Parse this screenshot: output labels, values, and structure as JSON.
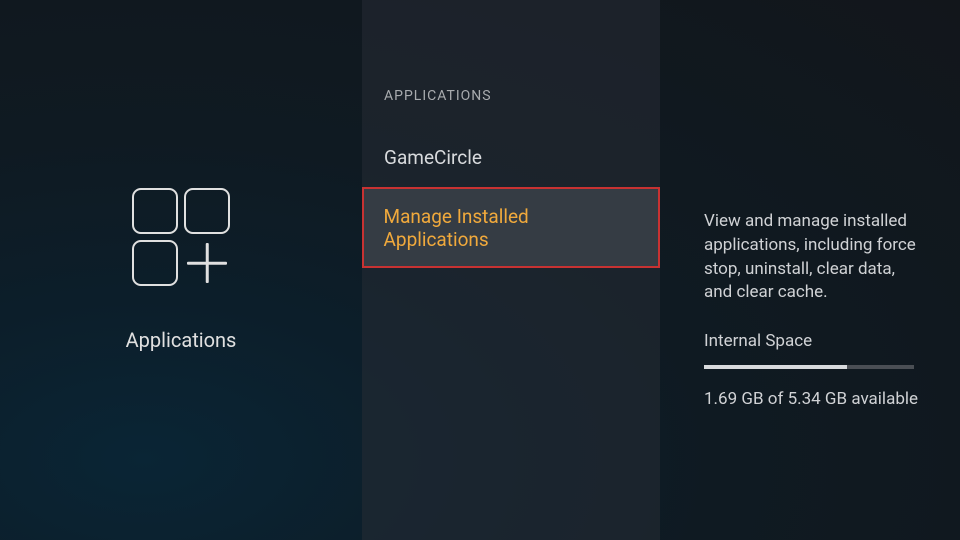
{
  "left": {
    "title": "Applications"
  },
  "middle": {
    "header": "APPLICATIONS",
    "items": [
      {
        "label": "GameCircle",
        "selected": false
      },
      {
        "label": "Manage Installed Applications",
        "selected": true
      }
    ]
  },
  "right": {
    "description": "View and manage installed applications, including force stop, uninstall, clear data, and clear cache.",
    "space_label": "Internal Space",
    "space_used_percent": 68,
    "space_details": "1.69 GB of 5.34 GB available"
  }
}
